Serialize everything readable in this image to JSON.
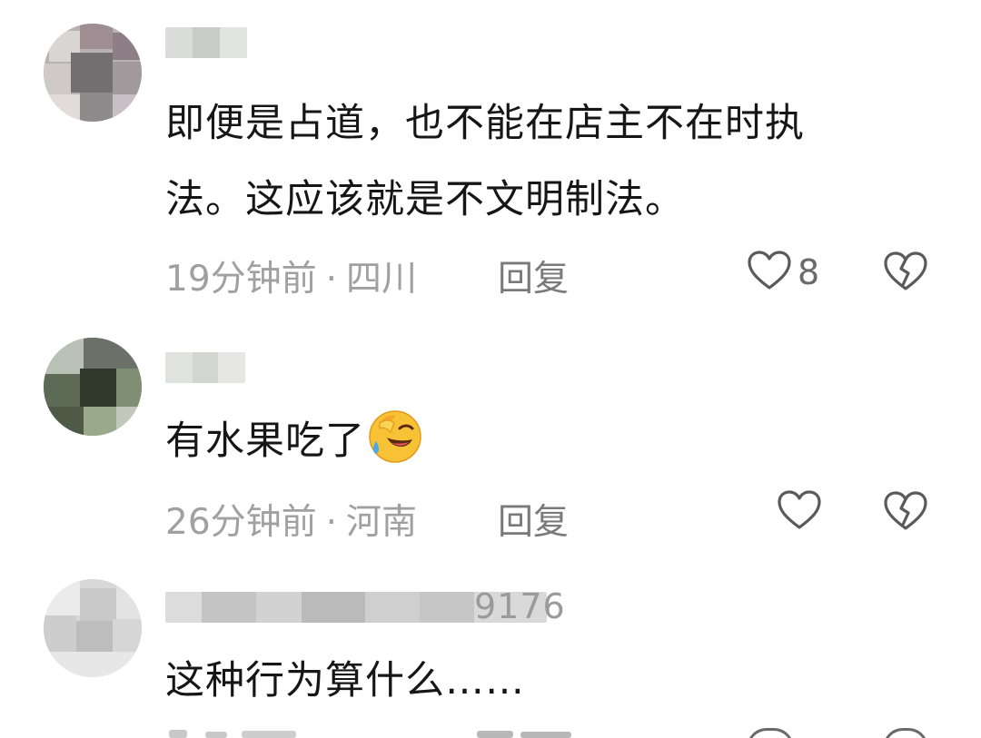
{
  "comments": [
    {
      "text_line1": "即便是占道，也不能在店主不在时执",
      "text_line2": "法。这应该就是不文明制法。",
      "time": "19分钟前",
      "separator": "·",
      "location": "四川",
      "reply_label": "回复",
      "likes": "8",
      "like_icon": "heart-outline-icon",
      "dislike_icon": "broken-heart-icon"
    },
    {
      "text": "有水果吃了",
      "emoji": "laughing-crying-emoji",
      "time": "26分钟前",
      "separator": "·",
      "location": "河南",
      "reply_label": "回复",
      "likes": "",
      "like_icon": "heart-outline-icon",
      "dislike_icon": "broken-heart-icon"
    },
    {
      "username_visible_tail": "9176",
      "text": "这种行为算什么……",
      "reply_label": "回复"
    }
  ],
  "colors": {
    "text": "#161616",
    "meta": "#a0a0a0",
    "icon": "#5a5a5a"
  }
}
